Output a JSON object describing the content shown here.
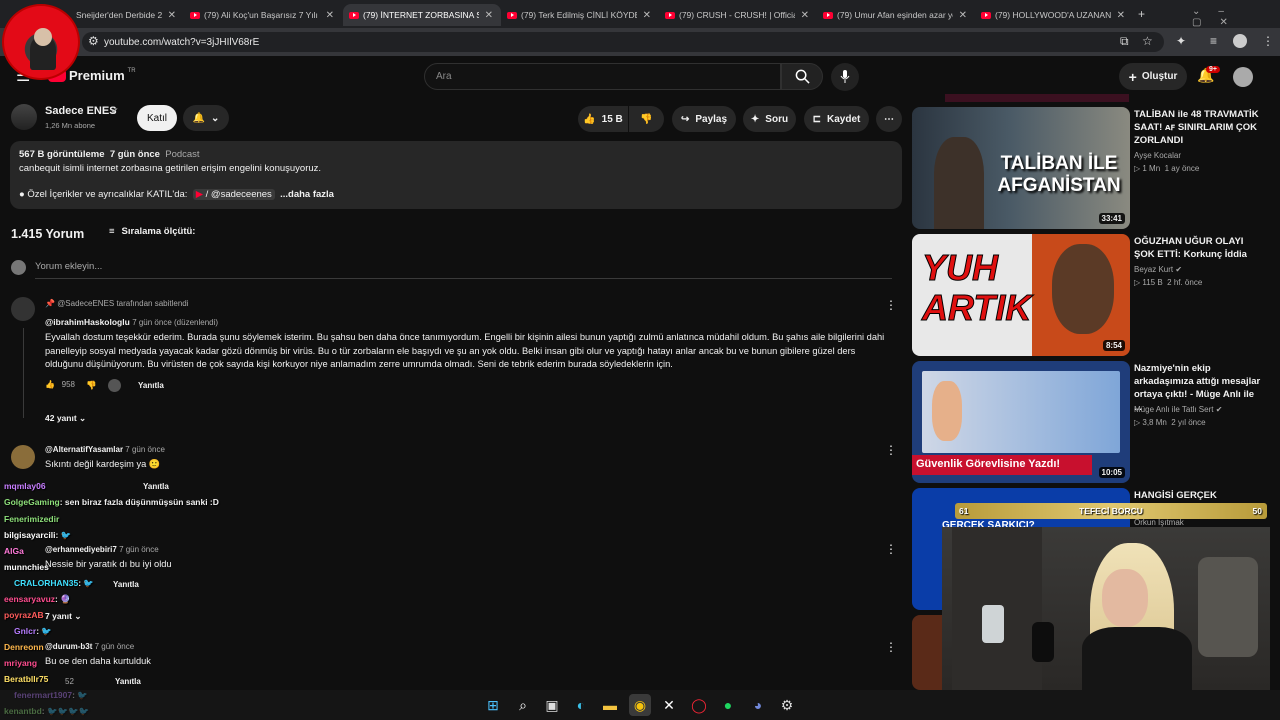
{
  "browser": {
    "tabs": [
      {
        "label": "Sneijder'den Derbide 2"
      },
      {
        "label": "(79) Ali Koç'un Başarısız 7 Yılı |"
      },
      {
        "label": "(79) İNTERNET ZORBASINA SON"
      },
      {
        "label": "(79) Terk Edilmiş CİNLİ KÖYDE"
      },
      {
        "label": "(79) CRUSH - CRUSH! | Official"
      },
      {
        "label": "(79) Umur Afan eşinden azar yo"
      },
      {
        "label": "(79) HOLLYWOOD'A UZANAN"
      }
    ],
    "url": "youtube.com/watch?v=3jJHIlV68rE"
  },
  "header": {
    "logo": "Premium",
    "logo_sup": "TR",
    "search_placeholder": "Ara",
    "create_label": "Oluştur",
    "notif_badge": "9+"
  },
  "channel": {
    "name": "Sadece ENES",
    "subs": "1,26 Mn abone",
    "join_label": "Katıl"
  },
  "actions": {
    "likes": "15 B",
    "share": "Paylaş",
    "ask": "Soru",
    "save": "Kaydet"
  },
  "description": {
    "views": "567 B görüntüleme",
    "age": "7 gün önce",
    "tag": "Podcast",
    "line1": "canbequit isimli internet zorbasına getirilen erişim engelini konuşuyoruz.",
    "line2": "● Özel İçerikler ve ayrıcalıklar KATIL'da:",
    "handle": "/ @sadeceenes",
    "more": "...daha fazla"
  },
  "comments_header": {
    "count": "1.415 Yorum",
    "sort": "Sıralama ölçütü:",
    "add_placeholder": "Yorum ekleyin..."
  },
  "comments": [
    {
      "pinned": "@SadeceENES tarafından sabitlendi",
      "author": "@ibrahimHaskologlu",
      "time": "7 gün önce (düzenlendi)",
      "text": "Eyvallah dostum teşekkür ederim. Burada şunu söylemek isterim. Bu şahsu ben daha önce tanımıyordum. Engelli bir kişinin ailesi bunun yaptığı zulmü anlatınca müdahil oldum. Bu şahıs aile bilgilerini dahi panelleyip sosyal medyada yayacak kadar gözü dönmüş bir virüs. Bu o tür zorbaların ele başıydı ve şu an yok oldu. Belki insan gibi olur ve yaptığı hatayı anlar ancak bu ve bunun gibilere güzel ders olduğunu düşünüyorum. Bu virüsten de çok sayıda kişi korkuyor niye anlamadım zerre umrumda olmadı. Seni de tebrik ederim burada söyledeklerin için.",
      "likes": "958",
      "reply": "Yanıtla",
      "replies": "42 yanıt"
    },
    {
      "author": "@AlternatifYasamlar",
      "time": "7 gün önce",
      "text": "Sıkıntı değil kardeşim ya 🙂",
      "reply": "Yanıtla"
    },
    {
      "author": "@erhannediyebiri7",
      "time": "7 gün önce",
      "text": "Nessie bir yaratık dı bu iyi oldu",
      "reply": "Yanıtla",
      "replies": "7 yanıt"
    },
    {
      "author": "@durum-b3t",
      "time": "7 gün önce",
      "text": "Bu oe den daha kurtulduk",
      "likes": "52",
      "reply": "Yanıtla"
    }
  ],
  "sidebar": [
    {
      "title": "TALİBAN ile 48 TRAVMATİK SAAT! ᴀꜰ SINIRLARIM ÇOK ZORLANDI",
      "channel": "Ayşe Kocalar",
      "views": "▷ 1 Mn",
      "age": "1 ay önce",
      "duration": "33:41",
      "thumb_text": "TALİBAN İLE AFGANİSTAN"
    },
    {
      "title": "OĞUZHAN UĞUR OLAYI ŞOK ETTİ: Korkunç İddia",
      "channel": "Beyaz Kurt",
      "views": "▷ 115 B",
      "age": "2 hf. önce",
      "duration": "8:54",
      "thumb_text": "YUH ARTIK"
    },
    {
      "title": "Nazmiye'nin ekip arkadaşımıza attığı mesajlar ortaya çıktı! - Müge Anlı ile ...",
      "channel": "Müge Anlı ile Tatlı Sert",
      "views": "▷ 3,8 Mn",
      "age": "2 yıl önce",
      "duration": "10:05",
      "thumb_text": "Güvenlik Görevlisine Yazdı!"
    },
    {
      "title": "HANGİSİ GERÇEK ŞARKICI?",
      "channel": "Orkun Işıtmak",
      "thumb_text": "GERÇEK ŞARKICI?"
    }
  ],
  "overlay": {
    "bar_left": "61",
    "bar_title": "TEFECİ BORCU",
    "bar_right": "50"
  },
  "chat": [
    {
      "user": "mqmlay06",
      "msg": "",
      "color": "#c77dff"
    },
    {
      "user": "GolgeGaming",
      "msg": ": sen biraz fazla düşünmüşsün sanki :D",
      "color": "#8ee07a"
    },
    {
      "user": "Fenerimizedir",
      "msg": ": 🎟",
      "color": "#8ee07a"
    },
    {
      "user": "bilgisayarcili",
      "msg": ": 🐦",
      "color": "#ffffff"
    },
    {
      "user": "AlGa",
      "msg": ": 🐦🐦",
      "color": "#ff7ad9"
    },
    {
      "user": "munnchies",
      "msg": ": 🐦",
      "color": "#ffffff"
    },
    {
      "user": "CRALORHAN35",
      "msg": ": 🐦",
      "color": "#40e0ff"
    },
    {
      "user": "eensaryavuz",
      "msg": ": 🔮",
      "color": "#ff4d8f"
    },
    {
      "user": "poyrazAB",
      "msg": ": 🐦",
      "color": "#ff5b5b"
    },
    {
      "user": "Gnlcr",
      "msg": ": 🐦",
      "color": "#b77dff"
    },
    {
      "user": "Denreonn",
      "msg": ": 🐦",
      "color": "#ffb84d"
    },
    {
      "user": "mriyang",
      "msg": ": 🐦",
      "color": "#ff4d8f"
    },
    {
      "user": "Beratbllr75",
      "msg": ": 🐦",
      "color": "#ffe066"
    },
    {
      "user": "fenermart1907",
      "msg": ": 🐦",
      "color": "#b77dff"
    },
    {
      "user": "kenantbd",
      "msg": ": 🐦🐦🐦🐦",
      "color": "#8ee07a"
    }
  ],
  "colors": {
    "accent": "#ff0033",
    "bg": "#0f0f0f"
  }
}
